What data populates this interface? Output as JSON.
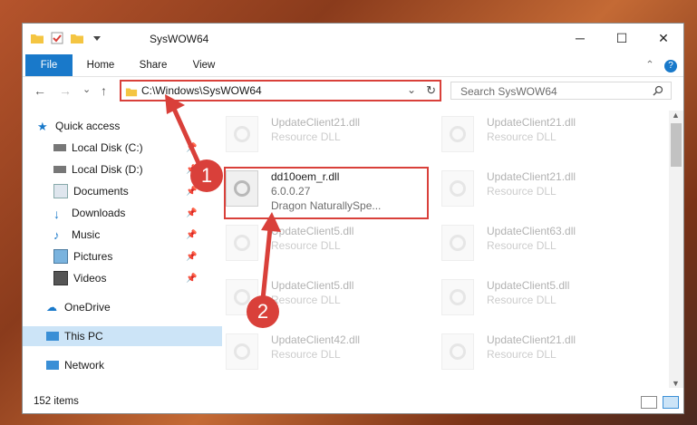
{
  "window": {
    "title": "SysWOW64",
    "minimize": "─",
    "maximize": "☐",
    "close": "✕",
    "help": "?"
  },
  "ribbon": {
    "tabs": [
      "File",
      "Home",
      "Share",
      "View"
    ],
    "collapse": "⌃"
  },
  "navigation": {
    "back": "←",
    "forward": "→",
    "recent": "⌄",
    "up": "↑",
    "path": "C:\\Windows\\SysWOW64",
    "refresh": "↻",
    "search_placeholder": "Search SysWOW64"
  },
  "sidebar": {
    "items": [
      {
        "label": "Quick access"
      },
      {
        "label": "Local Disk (C:)"
      },
      {
        "label": "Local Disk (D:)"
      },
      {
        "label": "Documents"
      },
      {
        "label": "Downloads"
      },
      {
        "label": "Music"
      },
      {
        "label": "Pictures"
      },
      {
        "label": "Videos"
      },
      {
        "label": "OneDrive"
      },
      {
        "label": "This PC"
      },
      {
        "label": "Network"
      }
    ]
  },
  "files": [
    {
      "name": "UpdateClient21.dll",
      "type": "Resource DLL"
    },
    {
      "name": "UpdateClient21.dll",
      "type": "Resource DLL"
    },
    {
      "name": "dd10oem_r.dll",
      "version": "6.0.0.27",
      "company": "Dragon NaturallySpe..."
    },
    {
      "name": "UpdateClient21.dll",
      "type": "Resource DLL"
    },
    {
      "name": "UpdateClient5.dll",
      "type": "Resource DLL"
    },
    {
      "name": "UpdateClient63.dll",
      "type": "Resource DLL"
    },
    {
      "name": "UpdateClient5.dll",
      "type": "Resource DLL"
    },
    {
      "name": "UpdateClient5.dll",
      "type": "Resource DLL"
    },
    {
      "name": "UpdateClient42.dll",
      "type": "Resource DLL"
    },
    {
      "name": "UpdateClient21.dll",
      "type": "Resource DLL"
    }
  ],
  "status": {
    "count": "152 items"
  },
  "annotations": {
    "step1": "1",
    "step2": "2"
  },
  "colors": {
    "accent": "#1979ca",
    "highlight": "#d9403a"
  }
}
